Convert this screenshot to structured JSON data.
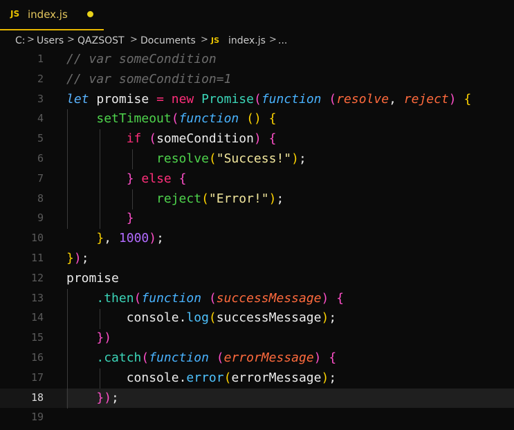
{
  "tab": {
    "icon": "JS",
    "label": "index.js",
    "modified_dot": "modified-dot-icon"
  },
  "breadcrumb": {
    "items": [
      "C:",
      "Users",
      "QAZSOST",
      "Documents",
      "index.js",
      "..."
    ],
    "js_icon": "JS",
    "separator": ">"
  },
  "colors": {
    "background": "#0b0b0b",
    "tab_accent": "#e8b800",
    "comment": "#6c6c6c",
    "keyword": "#5ab4ff",
    "operator": "#ff2e7a",
    "class": "#3bd5b8",
    "string": "#f2e79d",
    "number": "#b26bff",
    "param": "#ff6a3d",
    "call": "#4ed44c"
  },
  "editor": {
    "current_line": 18,
    "lines": [
      {
        "n": "1",
        "tokens": [
          [
            "t-com",
            "// var someCondition"
          ]
        ]
      },
      {
        "n": "2",
        "tokens": [
          [
            "t-com",
            "// var someCondition=1"
          ]
        ]
      },
      {
        "n": "3",
        "tokens": [
          [
            "t-kw",
            "let"
          ],
          [
            "t-plain",
            " promise "
          ],
          [
            "t-op",
            "="
          ],
          [
            "t-plain",
            " "
          ],
          [
            "t-new",
            "new"
          ],
          [
            "t-plain",
            " "
          ],
          [
            "t-cls",
            "Promise"
          ],
          [
            "t-p1",
            "("
          ],
          [
            "t-fn",
            "function"
          ],
          [
            "t-plain",
            " "
          ],
          [
            "t-p2",
            "("
          ],
          [
            "t-param",
            "resolve"
          ],
          [
            "t-punc",
            ", "
          ],
          [
            "t-param",
            "reject"
          ],
          [
            "t-p2",
            ")"
          ],
          [
            "t-plain",
            " "
          ],
          [
            "t-y",
            "{"
          ]
        ]
      },
      {
        "n": "4",
        "tokens": [
          [
            "t-plain",
            "    "
          ],
          [
            "t-call",
            "setTimeout"
          ],
          [
            "t-p2",
            "("
          ],
          [
            "t-fn",
            "function"
          ],
          [
            "t-plain",
            " "
          ],
          [
            "t-y",
            "()"
          ],
          [
            "t-plain",
            " "
          ],
          [
            "t-y",
            "{"
          ]
        ]
      },
      {
        "n": "5",
        "tokens": [
          [
            "t-plain",
            "        "
          ],
          [
            "t-op",
            "if"
          ],
          [
            "t-plain",
            " "
          ],
          [
            "t-p2",
            "("
          ],
          [
            "t-plain",
            "someCondition"
          ],
          [
            "t-p2",
            ")"
          ],
          [
            "t-plain",
            " "
          ],
          [
            "t-p2",
            "{"
          ]
        ]
      },
      {
        "n": "6",
        "tokens": [
          [
            "t-plain",
            "            "
          ],
          [
            "t-call",
            "resolve"
          ],
          [
            "t-y",
            "("
          ],
          [
            "t-str",
            "\"Success!\""
          ],
          [
            "t-y",
            ")"
          ],
          [
            "t-punc",
            ";"
          ]
        ]
      },
      {
        "n": "7",
        "tokens": [
          [
            "t-plain",
            "        "
          ],
          [
            "t-p2",
            "}"
          ],
          [
            "t-plain",
            " "
          ],
          [
            "t-op",
            "else"
          ],
          [
            "t-plain",
            " "
          ],
          [
            "t-p2",
            "{"
          ]
        ]
      },
      {
        "n": "8",
        "tokens": [
          [
            "t-plain",
            "            "
          ],
          [
            "t-call",
            "reject"
          ],
          [
            "t-y",
            "("
          ],
          [
            "t-str",
            "\"Error!\""
          ],
          [
            "t-y",
            ")"
          ],
          [
            "t-punc",
            ";"
          ]
        ]
      },
      {
        "n": "9",
        "tokens": [
          [
            "t-plain",
            "        "
          ],
          [
            "t-p2",
            "}"
          ]
        ]
      },
      {
        "n": "10",
        "tokens": [
          [
            "t-plain",
            "    "
          ],
          [
            "t-y",
            "}"
          ],
          [
            "t-punc",
            ", "
          ],
          [
            "t-num",
            "1000"
          ],
          [
            "t-p2",
            ")"
          ],
          [
            "t-punc",
            ";"
          ]
        ]
      },
      {
        "n": "11",
        "tokens": [
          [
            "t-y",
            "}"
          ],
          [
            "t-p1",
            ")"
          ],
          [
            "t-punc",
            ";"
          ]
        ]
      },
      {
        "n": "12",
        "tokens": [
          [
            "t-plain",
            "promise"
          ]
        ]
      },
      {
        "n": "13",
        "tokens": [
          [
            "t-plain",
            "    "
          ],
          [
            "t-method",
            ".then"
          ],
          [
            "t-p1",
            "("
          ],
          [
            "t-fn",
            "function"
          ],
          [
            "t-plain",
            " "
          ],
          [
            "t-p2",
            "("
          ],
          [
            "t-param",
            "successMessage"
          ],
          [
            "t-p2",
            ")"
          ],
          [
            "t-plain",
            " "
          ],
          [
            "t-p2",
            "{"
          ]
        ]
      },
      {
        "n": "14",
        "tokens": [
          [
            "t-plain",
            "        console"
          ],
          [
            "t-punc",
            "."
          ],
          [
            "t-prop",
            "log"
          ],
          [
            "t-y",
            "("
          ],
          [
            "t-plain",
            "successMessage"
          ],
          [
            "t-y",
            ")"
          ],
          [
            "t-punc",
            ";"
          ]
        ]
      },
      {
        "n": "15",
        "tokens": [
          [
            "t-plain",
            "    "
          ],
          [
            "t-p2",
            "}"
          ],
          [
            "t-p1",
            ")"
          ]
        ]
      },
      {
        "n": "16",
        "tokens": [
          [
            "t-plain",
            "    "
          ],
          [
            "t-method",
            ".catch"
          ],
          [
            "t-p1",
            "("
          ],
          [
            "t-fn",
            "function"
          ],
          [
            "t-plain",
            " "
          ],
          [
            "t-p2",
            "("
          ],
          [
            "t-param",
            "errorMessage"
          ],
          [
            "t-p2",
            ")"
          ],
          [
            "t-plain",
            " "
          ],
          [
            "t-p2",
            "{"
          ]
        ]
      },
      {
        "n": "17",
        "tokens": [
          [
            "t-plain",
            "        console"
          ],
          [
            "t-punc",
            "."
          ],
          [
            "t-prop",
            "error"
          ],
          [
            "t-y",
            "("
          ],
          [
            "t-plain",
            "errorMessage"
          ],
          [
            "t-y",
            ")"
          ],
          [
            "t-punc",
            ";"
          ]
        ]
      },
      {
        "n": "18",
        "tokens": [
          [
            "t-plain",
            "    "
          ],
          [
            "t-p2",
            "}"
          ],
          [
            "t-p1",
            ")"
          ],
          [
            "t-punc",
            ";"
          ]
        ]
      },
      {
        "n": "19",
        "tokens": []
      }
    ]
  }
}
